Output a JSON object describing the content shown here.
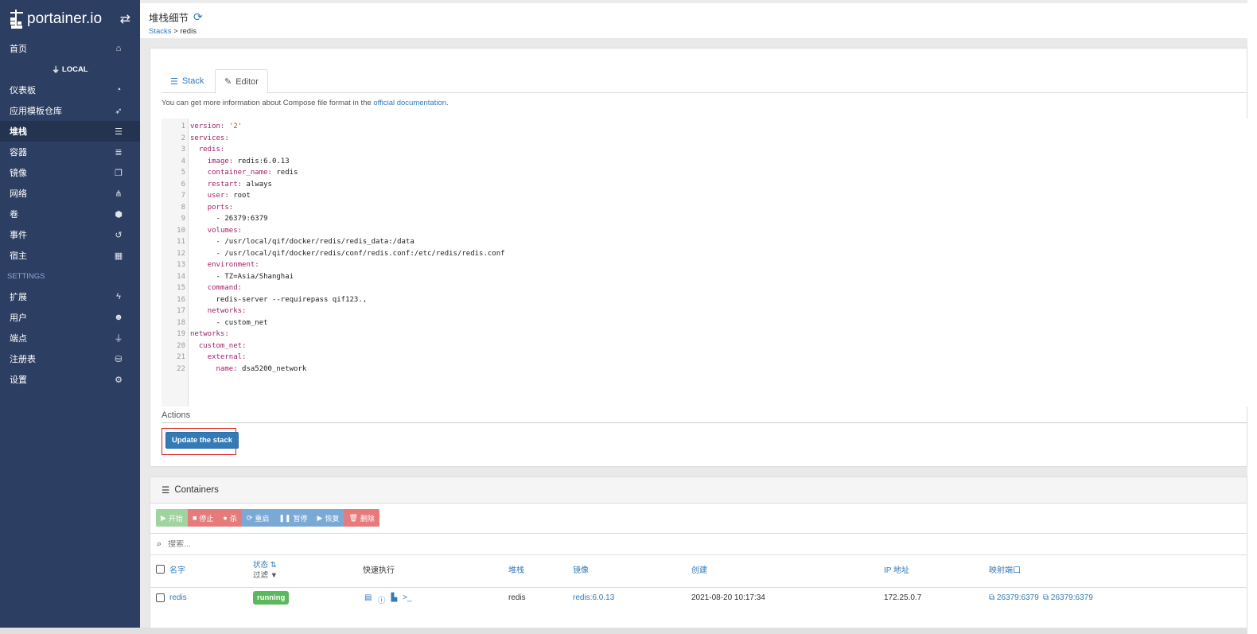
{
  "sidebar": {
    "brand": "portainer.io",
    "home": "首页",
    "endpoint": "LOCAL",
    "items": [
      {
        "label": "仪表板",
        "icon": "tachometer-icon"
      },
      {
        "label": "应用模板仓库",
        "icon": "rocket-icon"
      },
      {
        "label": "堆栈",
        "icon": "th-list-icon",
        "active": true
      },
      {
        "label": "容器",
        "icon": "server-icon"
      },
      {
        "label": "镜像",
        "icon": "clone-icon"
      },
      {
        "label": "网络",
        "icon": "sitemap-icon"
      },
      {
        "label": "卷",
        "icon": "cubes-icon"
      },
      {
        "label": "事件",
        "icon": "history-icon"
      },
      {
        "label": "宿主",
        "icon": "th-icon"
      }
    ],
    "settings_section": "SETTINGS",
    "settings_items": [
      {
        "label": "扩展",
        "icon": "bolt-icon"
      },
      {
        "label": "用户",
        "icon": "users-icon"
      },
      {
        "label": "端点",
        "icon": "plug-icon"
      },
      {
        "label": "注册表",
        "icon": "database-icon"
      },
      {
        "label": "设置",
        "icon": "cogs-icon"
      }
    ]
  },
  "header": {
    "title": "堆栈细节",
    "breadcrumb_link": "Stacks",
    "breadcrumb_sep": ">",
    "breadcrumb_current": "redis"
  },
  "tabs": {
    "stack": "Stack",
    "editor": "Editor"
  },
  "info": {
    "text": "You can get more information about Compose file format in the",
    "link": "official documentation",
    "end": "."
  },
  "editor_lines": [
    "version: '2'",
    "services:",
    "  redis:",
    "    image: redis:6.0.13",
    "    container_name: redis",
    "    restart: always",
    "    user: root",
    "    ports:",
    "      - 26379:6379",
    "    volumes:",
    "      - /usr/local/qif/docker/redis/redis_data:/data",
    "      - /usr/local/qif/docker/redis/conf/redis.conf:/etc/redis/redis.conf",
    "    environment:",
    "      - TZ=Asia/Shanghai",
    "    command:",
    "      redis-server --requirepass qif123.,",
    "    networks:",
    "      - custom_net",
    "networks:",
    "  custom_net:",
    "    external:",
    "      name: dsa5200_network"
  ],
  "actions": {
    "title": "Actions",
    "update_button": "Update the stack"
  },
  "containers": {
    "title": "Containers",
    "toolbar": [
      {
        "label": "开始",
        "icon": "play-icon",
        "color": "#9fd39f"
      },
      {
        "label": "停止",
        "icon": "stop-icon",
        "color": "#e67b7b"
      },
      {
        "label": "杀",
        "icon": "bomb-icon",
        "color": "#e67b7b"
      },
      {
        "label": "重启",
        "icon": "sync-icon",
        "color": "#7ba9d6"
      },
      {
        "label": "暂停",
        "icon": "pause-icon",
        "color": "#7ba9d6"
      },
      {
        "label": "恢复",
        "icon": "play-icon",
        "color": "#7ba9d6"
      },
      {
        "label": "删除",
        "icon": "trash-icon",
        "color": "#e67b7b"
      }
    ],
    "search_placeholder": "搜索...",
    "columns": {
      "name": "名字",
      "state": "状态",
      "state_filter": "过滤",
      "quick_actions": "快速执行",
      "stack": "堆栈",
      "image": "镜像",
      "created": "创建",
      "ip": "IP 地址",
      "ports": "映射端口"
    },
    "rows": [
      {
        "name": "redis",
        "state": "running",
        "stack": "redis",
        "image": "redis:6.0.13",
        "created": "2021-08-20 10:17:34",
        "ip": "172.25.0.7",
        "ports": [
          "26379:6379",
          "26379:6379"
        ]
      }
    ]
  }
}
